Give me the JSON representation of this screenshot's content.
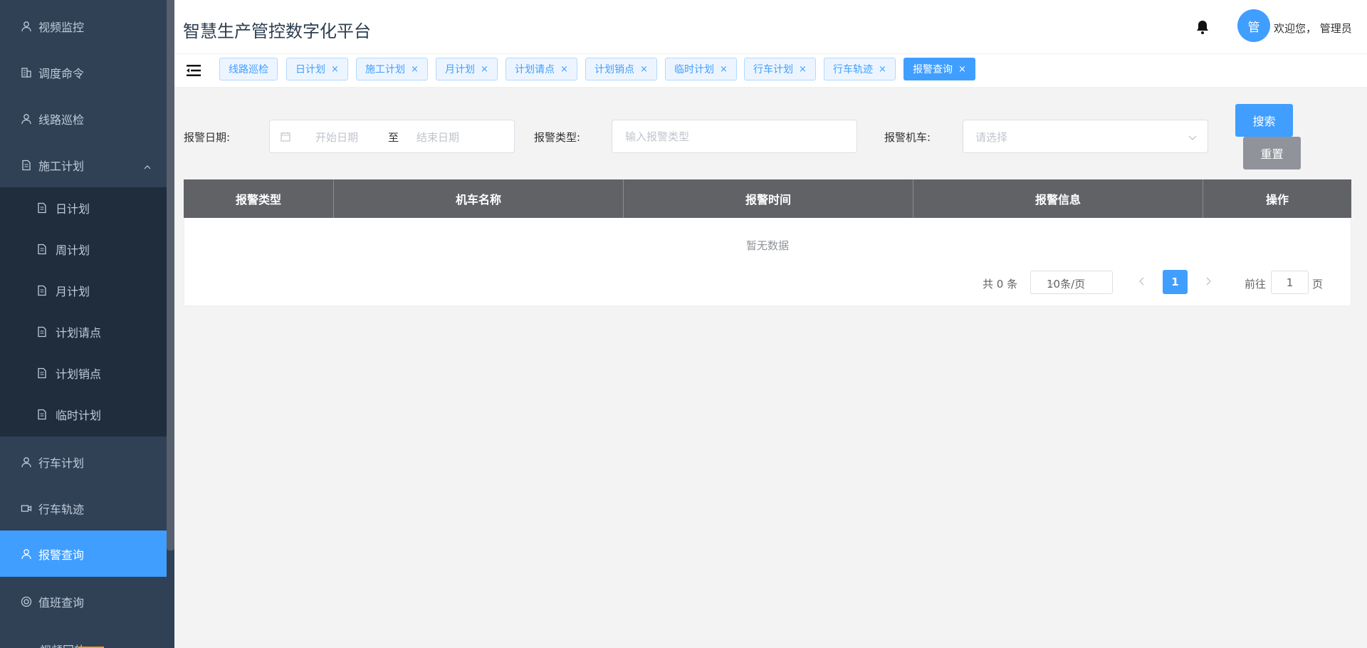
{
  "app": {
    "title": "智慧生产管控数字化平台",
    "welcome": "欢迎您， 管理员",
    "avatar_text": "管"
  },
  "colors": {
    "primary": "#409eff",
    "sidebar_bg": "#304156",
    "submenu_bg": "#1f2d3d",
    "table_header_bg": "#606266"
  },
  "sidebar": {
    "items": [
      {
        "label": "视频监控",
        "icon": "user-icon"
      },
      {
        "label": "调度命令",
        "icon": "building-icon"
      },
      {
        "label": "线路巡检",
        "icon": "user-icon"
      },
      {
        "label": "施工计划",
        "icon": "document-icon",
        "expanded": true
      },
      {
        "label": "行车计划",
        "icon": "user-icon"
      },
      {
        "label": "行车轨迹",
        "icon": "video-camera-icon"
      },
      {
        "label": "报警查询",
        "icon": "user-icon",
        "active": true
      },
      {
        "label": "值班查询",
        "icon": "lifebuoy-icon"
      },
      {
        "label": "视频回放",
        "icon": "video-icon"
      }
    ],
    "submenu": [
      {
        "label": "日计划",
        "icon": "document-icon"
      },
      {
        "label": "周计划",
        "icon": "document-icon"
      },
      {
        "label": "月计划",
        "icon": "document-icon"
      },
      {
        "label": "计划请点",
        "icon": "document-icon"
      },
      {
        "label": "计划销点",
        "icon": "document-icon"
      },
      {
        "label": "临时计划",
        "icon": "document-icon"
      }
    ]
  },
  "tags": [
    {
      "label": "线路巡检",
      "closable": false
    },
    {
      "label": "日计划",
      "closable": true
    },
    {
      "label": "施工计划",
      "closable": true
    },
    {
      "label": "月计划",
      "closable": true
    },
    {
      "label": "计划请点",
      "closable": true
    },
    {
      "label": "计划销点",
      "closable": true
    },
    {
      "label": "临时计划",
      "closable": true
    },
    {
      "label": "行车计划",
      "closable": true
    },
    {
      "label": "行车轨迹",
      "closable": true
    },
    {
      "label": "报警查询",
      "closable": true,
      "active": true
    }
  ],
  "tag_close": "×",
  "search": {
    "date_label": "报警日期:",
    "start_placeholder": "开始日期",
    "range_separator": "至",
    "end_placeholder": "结束日期",
    "type_label": "报警类型:",
    "type_placeholder": "输入报警类型",
    "loco_label": "报警机车:",
    "loco_placeholder": "请选择",
    "search_button": "搜索",
    "reset_button": "重置"
  },
  "table": {
    "columns": [
      "报警类型",
      "机车名称",
      "报警时间",
      "报警信息",
      "操作"
    ],
    "empty_text": "暂无数据"
  },
  "pagination": {
    "total": "共 0 条",
    "page_size": "10条/页",
    "current_page": "1",
    "goto_label": "前往",
    "goto_value": "1",
    "goto_suffix": "页"
  }
}
